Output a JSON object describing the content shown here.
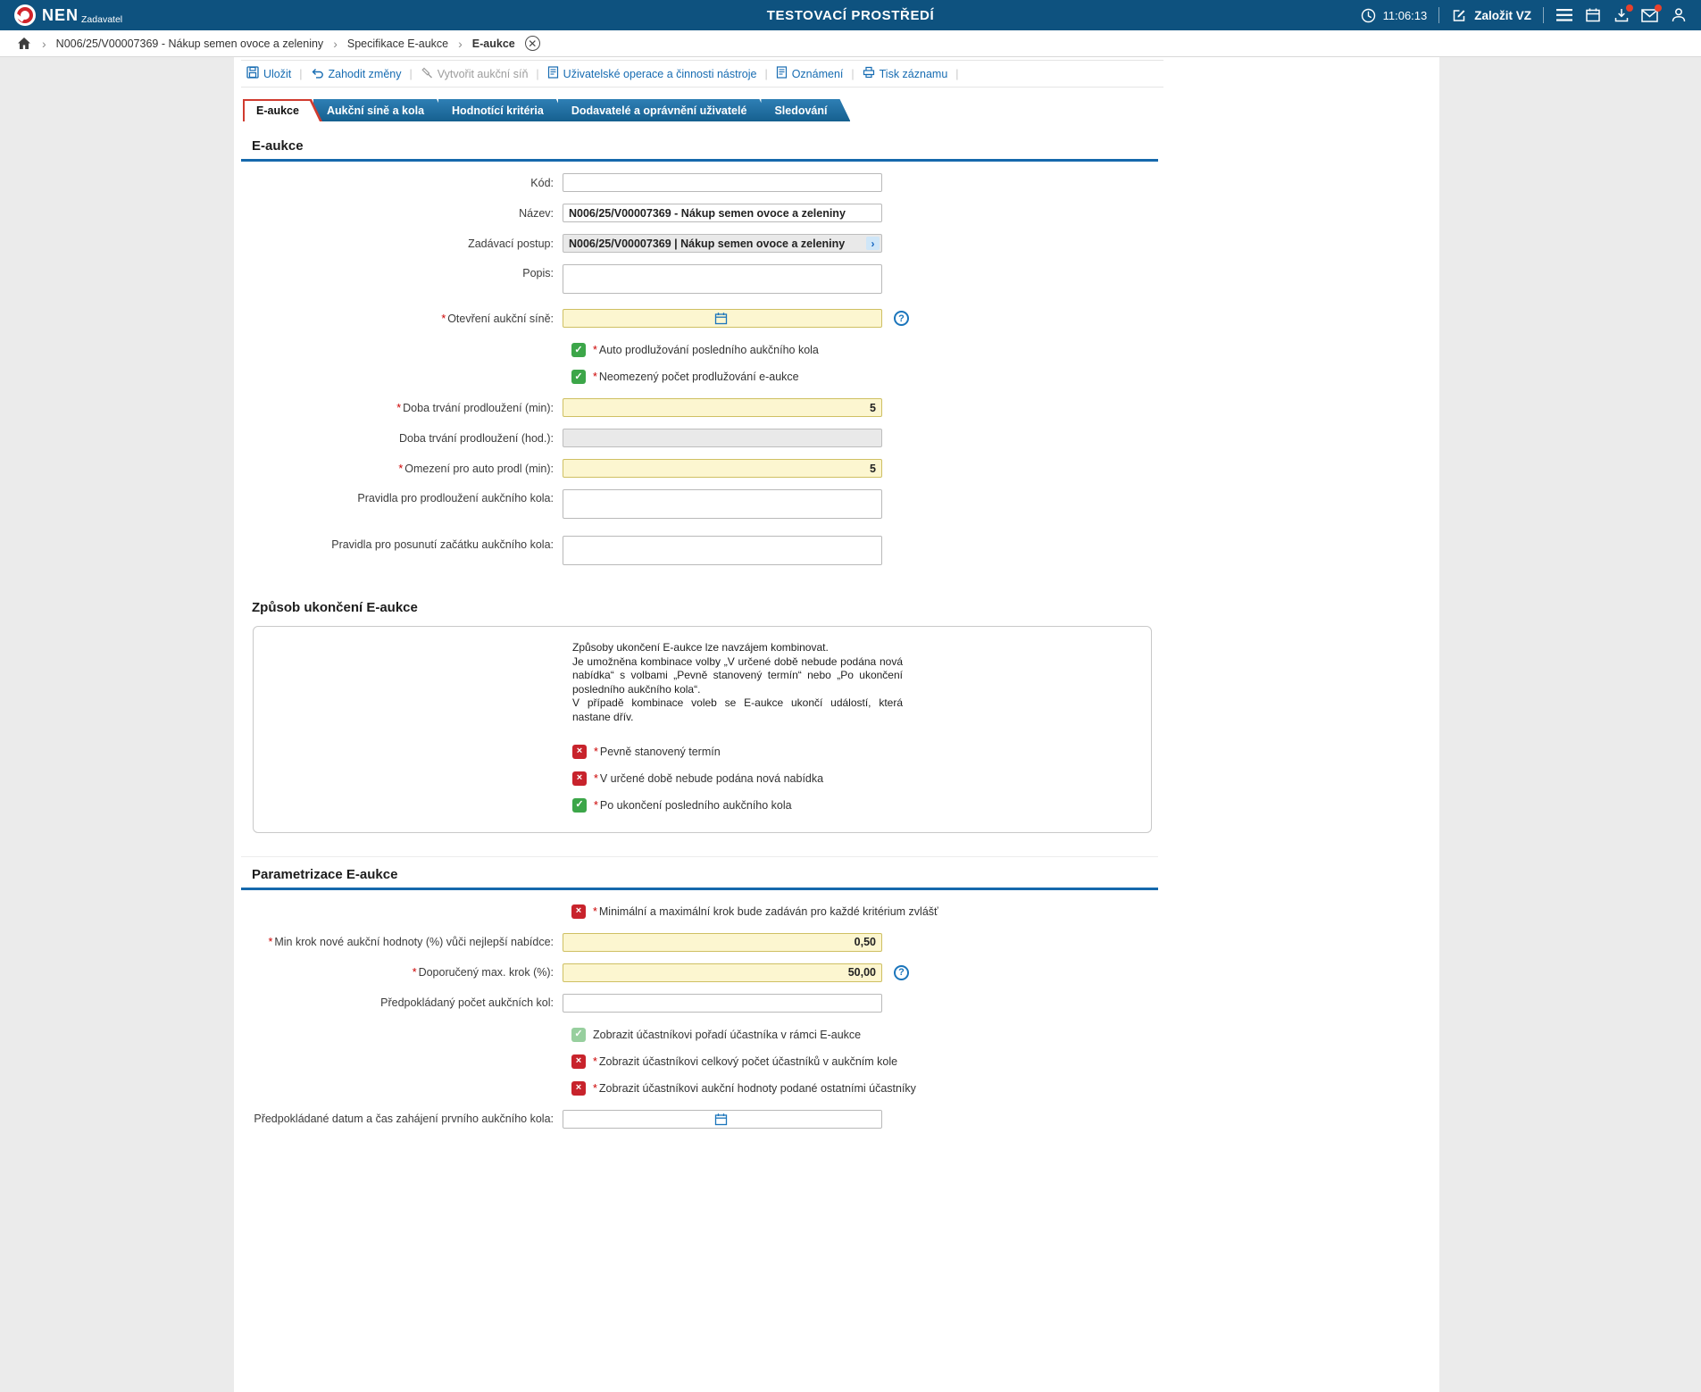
{
  "ui": {
    "required": "*"
  },
  "header": {
    "brand": "NEN",
    "brand_sub": "Zadavatel",
    "environment": "TESTOVACÍ PROSTŘEDÍ",
    "time": "11:06:13",
    "new_tender": "Založit VZ"
  },
  "breadcrumb": {
    "items": [
      "N006/25/V00007369 - Nákup semen ovoce a zeleniny",
      "Specifikace E-aukce",
      "E-aukce"
    ]
  },
  "toolbar": {
    "save": "Uložit",
    "discard": "Zahodit změny",
    "create_hall": "Vytvořit aukční síň",
    "user_ops": "Uživatelské operace a činnosti nástroje",
    "notices": "Oznámení",
    "print": "Tisk záznamu"
  },
  "tabs": [
    "E-aukce",
    "Aukční síně a kola",
    "Hodnotící kritéria",
    "Dodavatelé a oprávnění uživatelé",
    "Sledování"
  ],
  "eaukce": {
    "title": "E-aukce",
    "kod_label": "Kód:",
    "nazev_label": "Název:",
    "nazev_value": "N006/25/V00007369 - Nákup semen ovoce a zeleniny",
    "postup_label": "Zadávací postup:",
    "postup_value": "N006/25/V00007369 | Nákup semen ovoce a zeleniny",
    "popis_label": "Popis:",
    "otevreni_label": "Otevření aukční síně:",
    "auto_prodluzovani": "Auto prodlužování posledního aukčního kola",
    "neomezeny_pocet": "Neomezený počet prodlužování e-aukce",
    "doba_min_label": "Doba trvání prodloužení (min):",
    "doba_min_value": "5",
    "doba_hod_label": "Doba trvání prodloužení (hod.):",
    "omezeni_label": "Omezení pro auto prodl (min):",
    "omezeni_value": "5",
    "pravidla_prodlouzeni_label": "Pravidla pro prodloužení aukčního kola:",
    "pravidla_posunuti_label": "Pravidla pro posunutí začátku aukčního kola:"
  },
  "ukonceni": {
    "title": "Způsob ukončení E-aukce",
    "info_line1": "Způsoby ukončení E-aukce lze navzájem kombinovat.",
    "info_line2": "Je umožněna kombinace volby „V určené době nebude podána nová nabídka“ s volbami „Pevně stanovený termín“ nebo „Po ukončení posledního aukčního kola“.",
    "info_line3": "V případě kombinace voleb se E-aukce ukončí událostí, která nastane dřív.",
    "pevny_termin": "Pevně stanovený termín",
    "nova_nabidka": "V určené době nebude podána nová nabídka",
    "posledni_kolo": "Po ukončení posledního aukčního kola"
  },
  "parametrizace": {
    "title": "Parametrizace E-aukce",
    "krok_zvlast": "Minimální a maximální krok bude zadáván pro každé kritérium zvlášť",
    "min_krok_label": "Min krok nové aukční hodnoty (%) vůči nejlepší nabídce:",
    "min_krok_value": "0,50",
    "max_krok_label": "Doporučený max. krok (%):",
    "max_krok_value": "50,00",
    "pocet_kol_label": "Předpokládaný počet aukčních kol:",
    "poradi": "Zobrazit účastníkovi pořadí účastníka v rámci E-aukce",
    "pocet_ucastniku": "Zobrazit účastníkovi celkový počet účastníků v aukčním kole",
    "hodnoty_ostatnich": "Zobrazit účastníkovi aukční hodnoty podané ostatními účastníky",
    "datum_zahajeni_label": "Předpokládané datum a čas zahájení prvního aukčního kola:"
  }
}
